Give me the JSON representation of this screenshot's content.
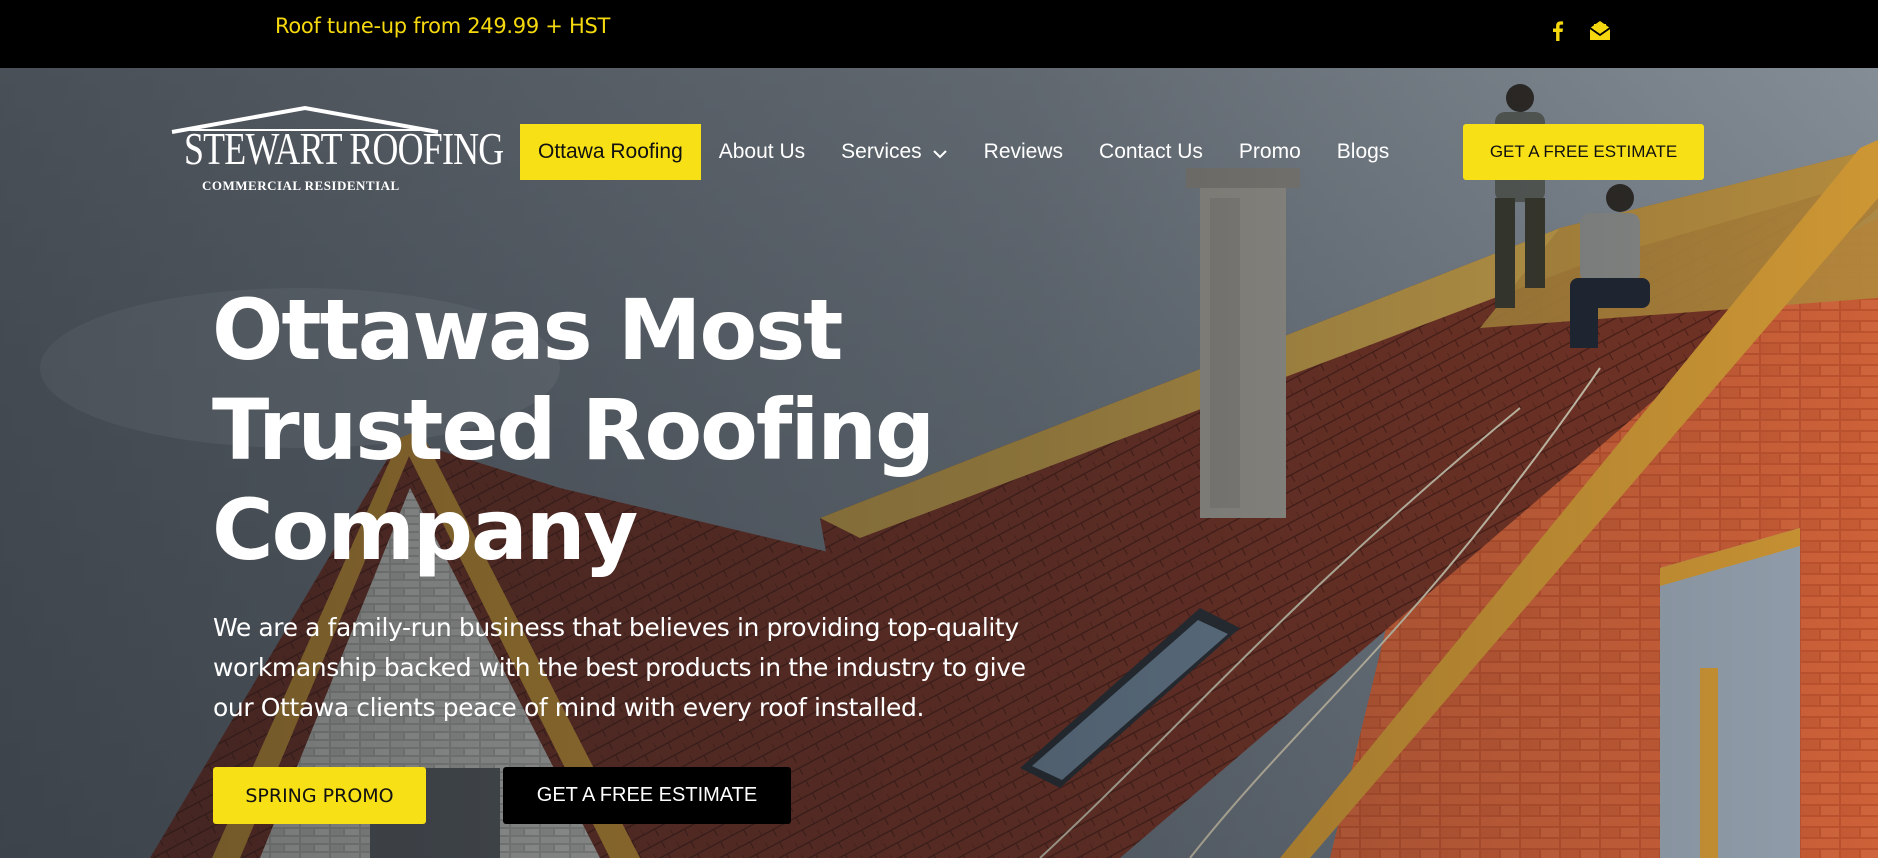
{
  "topbar": {
    "promo_text": "Roof tune-up from 249.99 + HST",
    "accent_color": "#f5d90e",
    "social_icons": [
      "facebook-icon",
      "email-icon"
    ]
  },
  "logo": {
    "name": "STEWART ROOFING",
    "tagline": "COMMERCIAL RESIDENTIAL"
  },
  "nav": {
    "items": [
      {
        "label": "Ottawa Roofing",
        "active": true
      },
      {
        "label": "About Us"
      },
      {
        "label": "Services",
        "has_dropdown": true
      },
      {
        "label": "Reviews"
      },
      {
        "label": "Contact Us"
      },
      {
        "label": "Promo"
      },
      {
        "label": "Blogs"
      }
    ],
    "cta_label": "GET A FREE ESTIMATE"
  },
  "hero": {
    "headline_lines": [
      "Ottawas Most",
      "Trusted Roofing",
      "Company"
    ],
    "description": "We are a family-run business that believes in providing top-quality workmanship backed with the best products in the industry to give our Ottawa clients peace of mind with every roof installed.",
    "primary_button": "SPRING PROMO",
    "secondary_button": "GET A FREE ESTIMATE"
  },
  "colors": {
    "brand_yellow": "#f7e016",
    "black": "#000000",
    "white": "#ffffff"
  }
}
